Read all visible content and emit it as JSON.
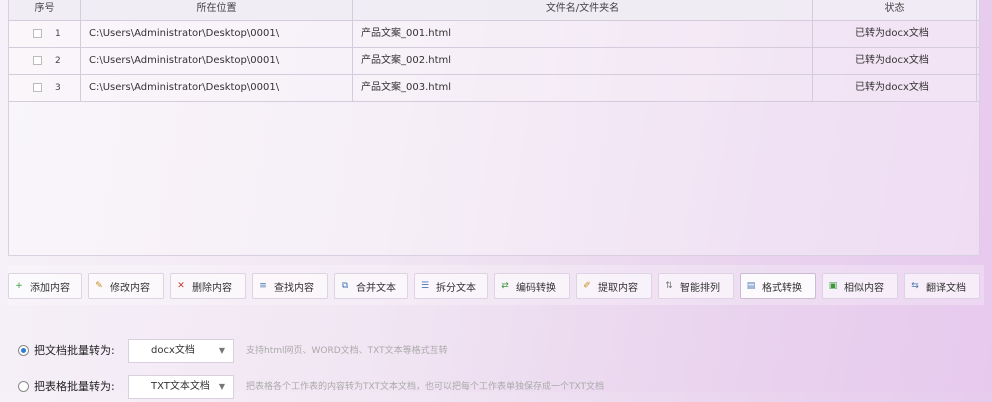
{
  "table": {
    "headers": {
      "index": "序号",
      "location": "所在位置",
      "filename": "文件名/文件夹名",
      "status": "状态"
    },
    "rows": [
      {
        "index": "1",
        "location": "C:\\Users\\Administrator\\Desktop\\0001\\",
        "filename": "产品文案_001.html",
        "status": "已转为docx文档"
      },
      {
        "index": "2",
        "location": "C:\\Users\\Administrator\\Desktop\\0001\\",
        "filename": "产品文案_002.html",
        "status": "已转为docx文档"
      },
      {
        "index": "3",
        "location": "C:\\Users\\Administrator\\Desktop\\0001\\",
        "filename": "产品文案_003.html",
        "status": "已转为docx文档"
      }
    ]
  },
  "toolbar": {
    "buttons": [
      {
        "label": "添加内容",
        "icon": "plus-circle-icon",
        "glyph": "+",
        "color": "#3a9a3a"
      },
      {
        "label": "修改内容",
        "icon": "edit-document-icon",
        "glyph": "✎",
        "color": "#c78a1e"
      },
      {
        "label": "删除内容",
        "icon": "delete-document-icon",
        "glyph": "✕",
        "color": "#c0392b"
      },
      {
        "label": "查找内容",
        "icon": "find-document-icon",
        "glyph": "≡",
        "color": "#4a78b5"
      },
      {
        "label": "合并文本",
        "icon": "merge-text-icon",
        "glyph": "⧉",
        "color": "#4a78b5"
      },
      {
        "label": "拆分文本",
        "icon": "split-text-icon",
        "glyph": "☰",
        "color": "#4a78b5"
      },
      {
        "label": "编码转换",
        "icon": "encoding-convert-icon",
        "glyph": "⇄",
        "color": "#3a9a3a"
      },
      {
        "label": "提取内容",
        "icon": "extract-content-icon",
        "glyph": "✐",
        "color": "#c78a1e"
      },
      {
        "label": "智能排列",
        "icon": "smart-sort-icon",
        "glyph": "⇅",
        "color": "#777777"
      },
      {
        "label": "格式转换",
        "icon": "format-convert-icon",
        "glyph": "▤",
        "color": "#4a78b5"
      },
      {
        "label": "相似内容",
        "icon": "similar-content-icon",
        "glyph": "▣",
        "color": "#3a9a3a"
      },
      {
        "label": "翻译文档",
        "icon": "translate-document-icon",
        "glyph": "⇆",
        "color": "#4a78b5"
      }
    ]
  },
  "options": {
    "option1": {
      "label": "把文档批量转为:",
      "select_value": "docx文档",
      "hint": "支持html网页、WORD文档、TXT文本等格式互转"
    },
    "option2": {
      "label": "把表格批量转为:",
      "select_value": "TXT文本文档",
      "hint": "把表格各个工作表的内容转为TXT文本文档，也可以把每个工作表单独保存成一个TXT文档"
    }
  },
  "colors": {
    "accent_radio": "#2e7cd6",
    "background_start": "#f6f1f8",
    "background_end": "#e7c9ee"
  }
}
